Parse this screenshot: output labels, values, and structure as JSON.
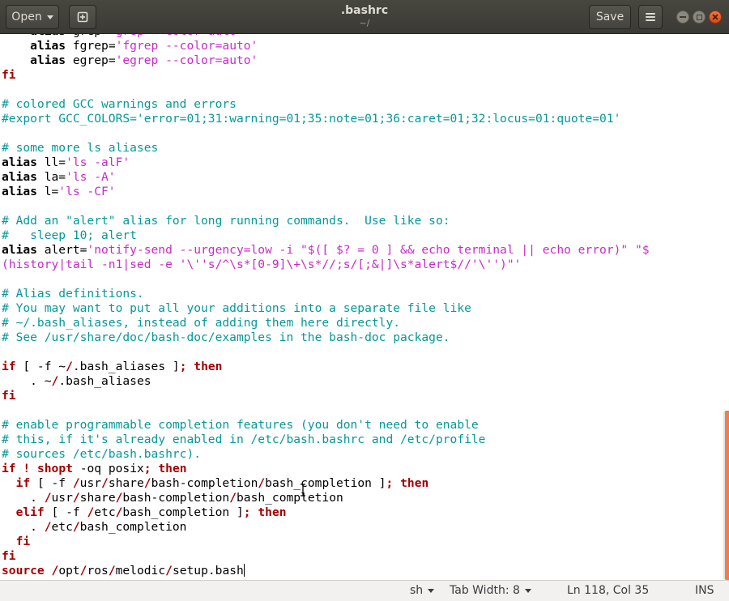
{
  "window": {
    "title": ".bashrc",
    "subtitle": "~/"
  },
  "header": {
    "open_label": "Open",
    "save_label": "Save",
    "icons": {
      "open_dropdown": "chevron-down-icon",
      "new_tab": "new-document-icon",
      "menu": "hamburger-menu-icon",
      "minimize": "minimize-icon",
      "maximize": "maximize-icon",
      "close": "close-icon"
    }
  },
  "editor": {
    "lines": [
      [
        [
          "    ",
          "p"
        ],
        [
          "alias ",
          "b"
        ],
        [
          "grep",
          "p"
        ],
        [
          "=",
          "p"
        ],
        [
          "'grep --color=auto'",
          "s"
        ]
      ],
      [
        [
          "    ",
          "p"
        ],
        [
          "alias ",
          "b"
        ],
        [
          "fgrep",
          "p"
        ],
        [
          "=",
          "p"
        ],
        [
          "'fgrep --color=auto'",
          "s"
        ]
      ],
      [
        [
          "    ",
          "p"
        ],
        [
          "alias ",
          "b"
        ],
        [
          "egrep",
          "p"
        ],
        [
          "=",
          "p"
        ],
        [
          "'egrep --color=auto'",
          "s"
        ]
      ],
      [
        [
          "fi",
          "k"
        ]
      ],
      [
        [
          "",
          "p"
        ]
      ],
      [
        [
          "# colored GCC warnings and errors",
          "c"
        ]
      ],
      [
        [
          "#export GCC_COLORS='error=01;31:warning=01;35:note=01;36:caret=01;32:locus=01:quote=01'",
          "c"
        ]
      ],
      [
        [
          "",
          "p"
        ]
      ],
      [
        [
          "# some more ls aliases",
          "c"
        ]
      ],
      [
        [
          "alias ",
          "b"
        ],
        [
          "ll=",
          "p"
        ],
        [
          "'ls -alF'",
          "s"
        ]
      ],
      [
        [
          "alias ",
          "b"
        ],
        [
          "la=",
          "p"
        ],
        [
          "'ls -A'",
          "s"
        ]
      ],
      [
        [
          "alias ",
          "b"
        ],
        [
          "l=",
          "p"
        ],
        [
          "'ls -CF'",
          "s"
        ]
      ],
      [
        [
          "",
          "p"
        ]
      ],
      [
        [
          "# Add an \"alert\" alias for long running commands.  Use like so:",
          "c"
        ]
      ],
      [
        [
          "#   sleep 10; alert",
          "c"
        ]
      ],
      [
        [
          "alias ",
          "b"
        ],
        [
          "alert=",
          "p"
        ],
        [
          "'notify-send --urgency=low -i \"$([ $? = 0 ] && echo terminal || echo error)\" \"$",
          "s"
        ]
      ],
      [
        [
          "(history|tail -n1|sed -e '\\''s/^\\s*[0-9]\\+\\s*//;s/[;&|]\\s*alert$//'\\'')\"'",
          "s"
        ]
      ],
      [
        [
          "",
          "p"
        ]
      ],
      [
        [
          "# Alias definitions.",
          "c"
        ]
      ],
      [
        [
          "# You may want to put all your additions into a separate file like",
          "c"
        ]
      ],
      [
        [
          "# ~/.bash_aliases, instead of adding them here directly.",
          "c"
        ]
      ],
      [
        [
          "# See /usr/share/doc/bash-doc/examples in the bash-doc package.",
          "c"
        ]
      ],
      [
        [
          "",
          "p"
        ]
      ],
      [
        [
          "if",
          "k"
        ],
        [
          " [ -f ~",
          "p"
        ],
        [
          "/",
          "k"
        ],
        [
          ".bash_aliases ]",
          "p"
        ],
        [
          ";",
          "k"
        ],
        [
          " ",
          "p"
        ],
        [
          "then",
          "k"
        ]
      ],
      [
        [
          "    . ~",
          "p"
        ],
        [
          "/",
          "k"
        ],
        [
          ".bash_aliases",
          "p"
        ]
      ],
      [
        [
          "fi",
          "k"
        ]
      ],
      [
        [
          "",
          "p"
        ]
      ],
      [
        [
          "# enable programmable completion features (you don't need to enable",
          "c"
        ]
      ],
      [
        [
          "# this, if it's already enabled in /etc/bash.bashrc and /etc/profile",
          "c"
        ]
      ],
      [
        [
          "# sources /etc/bash.bashrc).",
          "c"
        ]
      ],
      [
        [
          "if",
          "k"
        ],
        [
          " ",
          "p"
        ],
        [
          "!",
          "k"
        ],
        [
          " ",
          "p"
        ],
        [
          "shopt",
          "k"
        ],
        [
          " -oq posix",
          "p"
        ],
        [
          ";",
          "k"
        ],
        [
          " ",
          "p"
        ],
        [
          "then",
          "k"
        ]
      ],
      [
        [
          "  ",
          "p"
        ],
        [
          "if",
          "k"
        ],
        [
          " [ -f ",
          "p"
        ],
        [
          "/",
          "k"
        ],
        [
          "usr",
          "p"
        ],
        [
          "/",
          "k"
        ],
        [
          "share",
          "p"
        ],
        [
          "/",
          "k"
        ],
        [
          "bash-completion",
          "p"
        ],
        [
          "/",
          "k"
        ],
        [
          "bash_completion ]",
          "p"
        ],
        [
          ";",
          "k"
        ],
        [
          " ",
          "p"
        ],
        [
          "then",
          "k"
        ]
      ],
      [
        [
          "    . ",
          "p"
        ],
        [
          "/",
          "k"
        ],
        [
          "usr",
          "p"
        ],
        [
          "/",
          "k"
        ],
        [
          "share",
          "p"
        ],
        [
          "/",
          "k"
        ],
        [
          "bash-completion",
          "p"
        ],
        [
          "/",
          "k"
        ],
        [
          "bash_completion",
          "p"
        ]
      ],
      [
        [
          "  ",
          "p"
        ],
        [
          "elif",
          "k"
        ],
        [
          " [ -f ",
          "p"
        ],
        [
          "/",
          "k"
        ],
        [
          "etc",
          "p"
        ],
        [
          "/",
          "k"
        ],
        [
          "bash_completion ]",
          "p"
        ],
        [
          ";",
          "k"
        ],
        [
          " ",
          "p"
        ],
        [
          "then",
          "k"
        ]
      ],
      [
        [
          "    . ",
          "p"
        ],
        [
          "/",
          "k"
        ],
        [
          "etc",
          "p"
        ],
        [
          "/",
          "k"
        ],
        [
          "bash_completion",
          "p"
        ]
      ],
      [
        [
          "  ",
          "p"
        ],
        [
          "fi",
          "k"
        ]
      ],
      [
        [
          "fi",
          "k"
        ]
      ],
      [
        [
          "source",
          "k"
        ],
        [
          " ",
          "p"
        ],
        [
          "/",
          "k"
        ],
        [
          "opt",
          "p"
        ],
        [
          "/",
          "k"
        ],
        [
          "ros",
          "p"
        ],
        [
          "/",
          "k"
        ],
        [
          "melodic",
          "p"
        ],
        [
          "/",
          "k"
        ],
        [
          "setup.bash",
          "p"
        ]
      ]
    ]
  },
  "statusbar": {
    "language": "sh",
    "tab_width": "Tab Width: 8",
    "position": "Ln 118, Col 35",
    "mode": "INS"
  },
  "colors": {
    "comment": "#06989a",
    "keyword": "#a40000",
    "string": "#c82bc8",
    "scroll_thumb": "#ef7e4b",
    "headerbar": "#3f3e39"
  }
}
